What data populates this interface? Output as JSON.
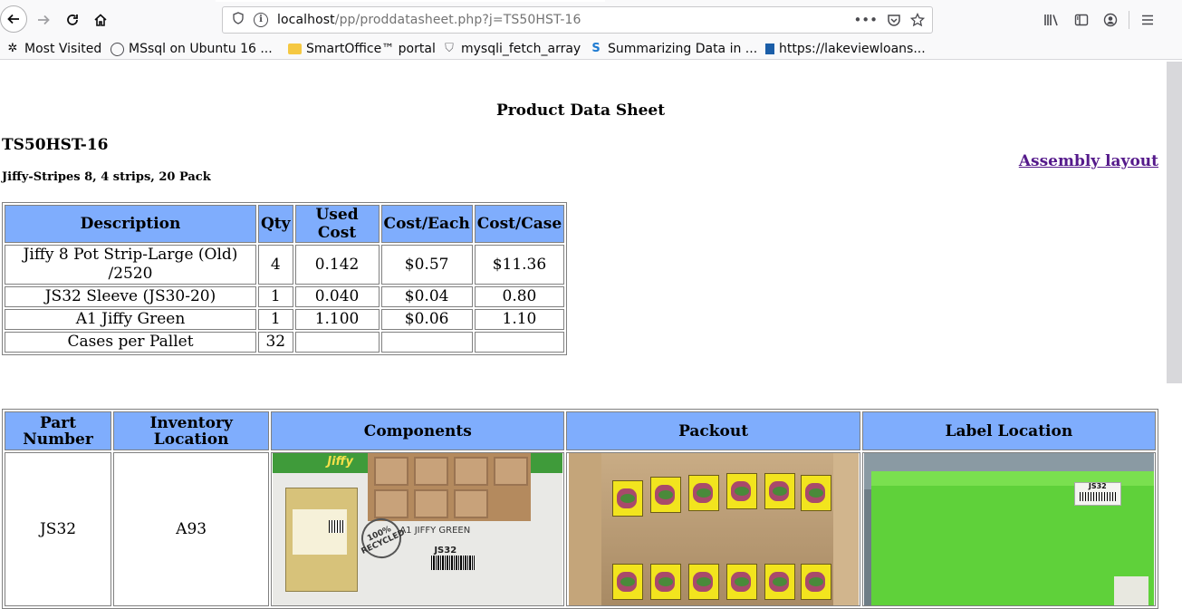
{
  "browser": {
    "url_host": "localhost",
    "url_path": "/pp/proddatasheet.php?j=TS50HST-16",
    "bookmarks": [
      {
        "label": "Most Visited",
        "icon": "gear-icon"
      },
      {
        "label": "MSsql on Ubuntu 16 ...",
        "icon": "globe-icon"
      },
      {
        "label": "SmartOffice™ portal",
        "icon": "folder-icon"
      },
      {
        "label": "mysqli_fetch_array",
        "icon": "shield-icon"
      },
      {
        "label": "Summarizing Data in ...",
        "icon": "s-logo-icon"
      },
      {
        "label": "https://lakeviewloans...",
        "icon": "site-icon"
      }
    ]
  },
  "page": {
    "title": "Product Data Sheet",
    "part_code": "TS50HST-16",
    "part_description": "Jiffy-Stripes 8, 4 strips, 20 Pack",
    "assembly_link": "Assembly layout"
  },
  "bom_table": {
    "headers": [
      "Description",
      "Qty",
      "Used Cost",
      "Cost/Each",
      "Cost/Case"
    ],
    "rows": [
      [
        "Jiffy 8 Pot Strip-Large (Old) /2520",
        "4",
        "0.142",
        "$0.57",
        "$11.36"
      ],
      [
        "JS32 Sleeve (JS30-20)",
        "1",
        "0.040",
        "$0.04",
        "0.80"
      ],
      [
        "A1 Jiffy Green",
        "1",
        "1.100",
        "$0.06",
        "1.10"
      ],
      [
        "Cases per Pallet",
        "32",
        "",
        "",
        ""
      ]
    ]
  },
  "parts_table": {
    "headers": [
      "Part Number",
      "Inventory Location",
      "Components",
      "Packout",
      "Label Location"
    ],
    "rows": [
      {
        "part_number": "JS32",
        "inventory_location": "A93",
        "photo_texts": {
          "brand": "Jiffy",
          "seal": "100% RECYCLED",
          "product": "A1 JIFFY GREEN",
          "code": "JS32",
          "label_code": "JS32"
        }
      }
    ]
  },
  "colors": {
    "header_bg": "#7fadfd",
    "visited_link": "#551a8b"
  }
}
